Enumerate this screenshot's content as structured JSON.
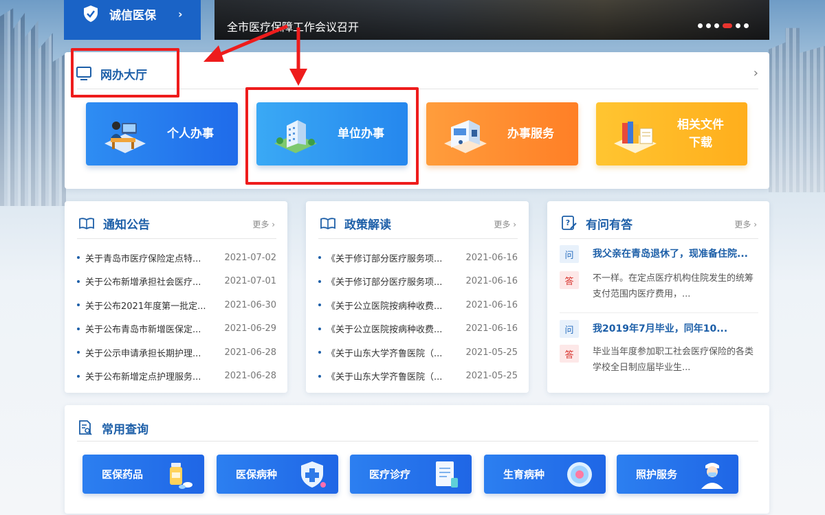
{
  "top": {
    "credit_label": "诚信医保",
    "credit_arrow": "›",
    "banner_caption": "全市医疗保障工作会议召开",
    "banner_dots": 5,
    "banner_active_dot": 3
  },
  "hall": {
    "title": "网办大厅",
    "chevron": "›",
    "tiles": [
      {
        "label": "个人办事"
      },
      {
        "label": "单位办事"
      },
      {
        "label": "办事服务"
      },
      {
        "label_line1": "相关文件",
        "label_line2": "下载"
      }
    ]
  },
  "notice": {
    "title": "通知公告",
    "more": "更多 ›",
    "items": [
      {
        "title": "关于青岛市医疗保险定点特...",
        "date": "2021-07-02"
      },
      {
        "title": "关于公布新增承担社会医疗...",
        "date": "2021-07-01"
      },
      {
        "title": "关于公布2021年度第一批定...",
        "date": "2021-06-30"
      },
      {
        "title": "关于公布青岛市新增医保定...",
        "date": "2021-06-29"
      },
      {
        "title": "关于公示申请承担长期护理...",
        "date": "2021-06-28"
      },
      {
        "title": "关于公布新增定点护理服务...",
        "date": "2021-06-28"
      }
    ]
  },
  "policy": {
    "title": "政策解读",
    "more": "更多 ›",
    "items": [
      {
        "title": "《关于修订部分医疗服务项...",
        "date": "2021-06-16"
      },
      {
        "title": "《关于修订部分医疗服务项...",
        "date": "2021-06-16"
      },
      {
        "title": "《关于公立医院按病种收费...",
        "date": "2021-06-16"
      },
      {
        "title": "《关于公立医院按病种收费...",
        "date": "2021-06-16"
      },
      {
        "title": "《关于山东大学齐鲁医院（...",
        "date": "2021-05-25"
      },
      {
        "title": "《关于山东大学齐鲁医院（...",
        "date": "2021-05-25"
      }
    ]
  },
  "qa": {
    "title": "有问有答",
    "more": "更多 ›",
    "q_badge": "问",
    "a_badge": "答",
    "items": [
      {
        "q": "我父亲在青岛退休了，现准备住院...",
        "a": "不一样。在定点医疗机构住院发生的统筹支付范围内医疗费用，..."
      },
      {
        "q": "我2019年7月毕业，同年10...",
        "a": "毕业当年度参加职工社会医疗保险的各类学校全日制应届毕业生..."
      }
    ]
  },
  "query": {
    "title": "常用查询",
    "buttons": [
      {
        "label": "医保药品"
      },
      {
        "label": "医保病种"
      },
      {
        "label": "医疗诊疗"
      },
      {
        "label": "生育病种"
      },
      {
        "label": "照护服务"
      }
    ]
  }
}
